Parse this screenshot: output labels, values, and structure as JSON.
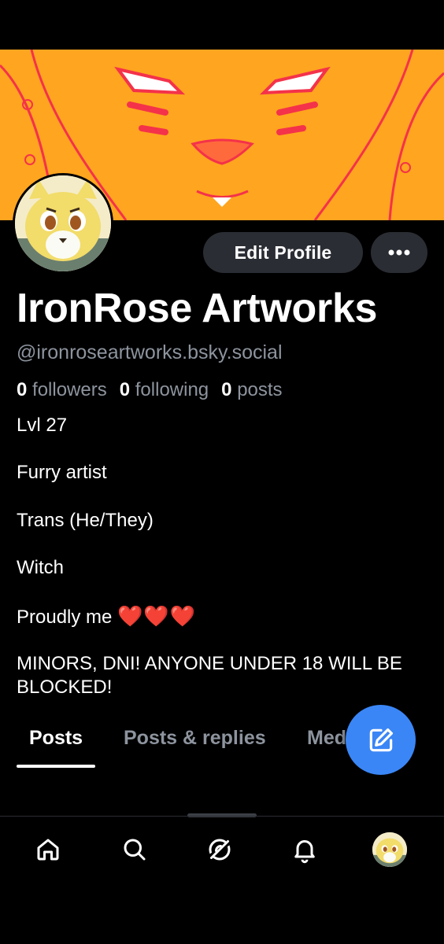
{
  "profile": {
    "display_name": "IronRose Artworks",
    "handle": "@ironroseartworks.bsky.social",
    "followers_count": "0",
    "followers_label": "followers",
    "following_count": "0",
    "following_label": "following",
    "posts_count": "0",
    "posts_label": "posts",
    "bio": {
      "line1": "Lvl 27",
      "line2": "Furry artist",
      "line3": "Trans (He/They)",
      "line4": "Witch",
      "line5_text": "Proudly me",
      "line5_emoji": "❤️❤️❤️",
      "line6a": "MINORS, DNI! ANYONE UNDER 18 WILL BE",
      "line6b": "BLOCKED!"
    }
  },
  "actions": {
    "edit_profile_label": "Edit Profile",
    "more_icon": "ellipsis-icon"
  },
  "tabs": [
    {
      "label": "Posts",
      "active": true
    },
    {
      "label": "Posts & replies",
      "active": false
    },
    {
      "label": "Med",
      "active": false
    }
  ],
  "fab": {
    "icon": "compose-icon"
  },
  "bottom_nav": [
    {
      "icon": "home-icon"
    },
    {
      "icon": "search-icon"
    },
    {
      "icon": "feeds-icon"
    },
    {
      "icon": "notifications-icon"
    },
    {
      "icon": "profile-avatar"
    }
  ],
  "colors": {
    "background": "#000000",
    "banner": "#ffa51f",
    "button_bg": "#2a2d33",
    "muted_text": "#8d949e",
    "fab": "#3a86f6",
    "heart": "#e03232"
  }
}
